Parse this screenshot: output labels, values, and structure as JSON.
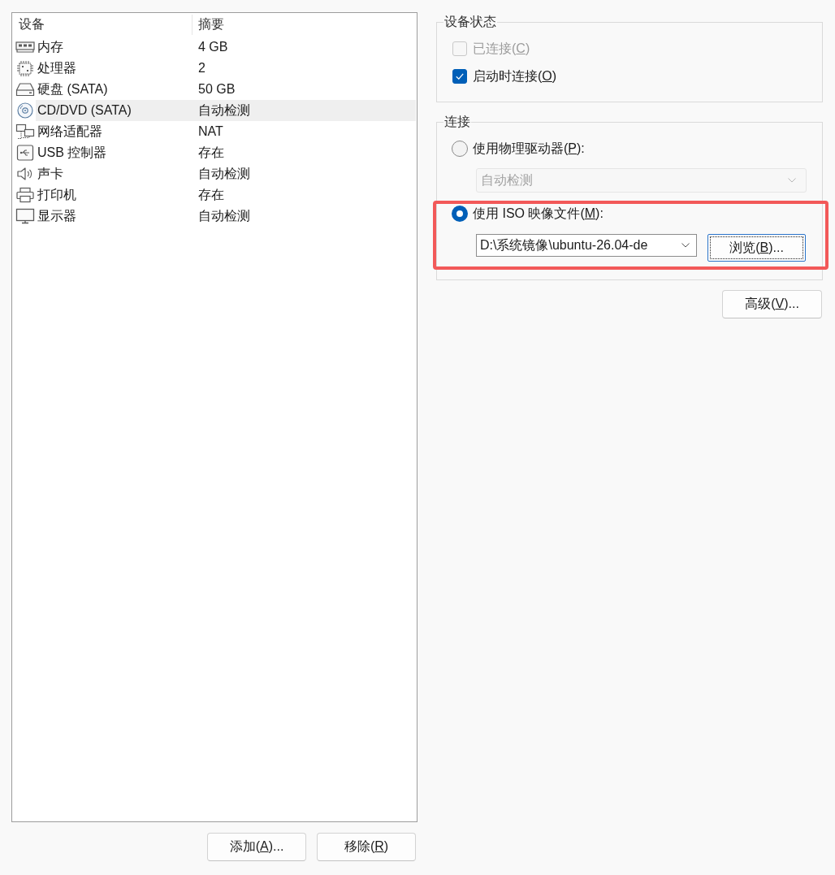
{
  "device_list": {
    "columns": [
      "设备",
      "摘要"
    ],
    "rows": [
      {
        "kind": "memory",
        "device": "内存",
        "summary": "4 GB",
        "selected": false
      },
      {
        "kind": "processor",
        "device": "处理器",
        "summary": "2",
        "selected": false
      },
      {
        "kind": "disk",
        "device": "硬盘 (SATA)",
        "summary": "50 GB",
        "selected": false
      },
      {
        "kind": "cd",
        "device": "CD/DVD (SATA)",
        "summary": "自动检测",
        "selected": true
      },
      {
        "kind": "network",
        "device": "网络适配器",
        "summary": "NAT",
        "selected": false
      },
      {
        "kind": "usb",
        "device": "USB 控制器",
        "summary": "存在",
        "selected": false
      },
      {
        "kind": "sound",
        "device": "声卡",
        "summary": "自动检测",
        "selected": false
      },
      {
        "kind": "printer",
        "device": "打印机",
        "summary": "存在",
        "selected": false
      },
      {
        "kind": "display",
        "device": "显示器",
        "summary": "自动检测",
        "selected": false
      }
    ]
  },
  "list_buttons": [
    {
      "text": "添加(",
      "access_key": "A",
      "text_after": ")..."
    },
    {
      "text": "移除(",
      "access_key": "R",
      "text_after": ")"
    }
  ],
  "device_status": {
    "title": "设备状态",
    "options": [
      {
        "text": "已连接(",
        "access_key": "C",
        "text_after": ")",
        "checked": false,
        "disabled": true
      },
      {
        "text": "启动时连接(",
        "access_key": "O",
        "text_after": ")",
        "checked": true,
        "disabled": false
      }
    ]
  },
  "connection": {
    "title": "连接",
    "options": [
      {
        "kind": "physical",
        "text": "使用物理驱动器(",
        "access_key": "P",
        "text_after": "):",
        "selected": false,
        "drive_select": {
          "value": "自动检测",
          "disabled": true
        }
      },
      {
        "kind": "iso",
        "text": "使用 ISO 映像文件(",
        "access_key": "M",
        "text_after": "):",
        "selected": true,
        "highlighted": true,
        "path_combo": {
          "value": "D:\\系统镜像\\ubuntu-26.04-de",
          "disabled": false
        },
        "browse_button": {
          "text": "浏览(",
          "access_key": "B",
          "text_after": ")...",
          "focused": true
        }
      }
    ]
  },
  "advanced_button": {
    "text": "高级(",
    "access_key": "V",
    "text_after": ")..."
  }
}
